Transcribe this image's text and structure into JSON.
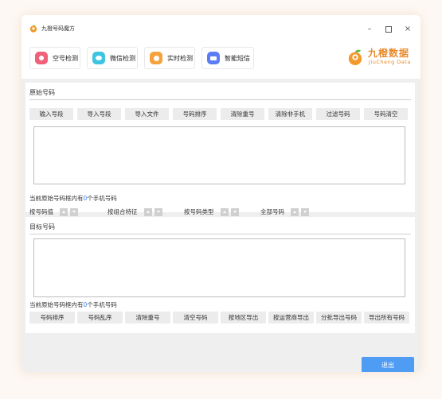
{
  "window": {
    "title": "九橙号码魔方"
  },
  "toolbar": {
    "items": [
      {
        "label": "空号检测",
        "icon": "empty-number-icon",
        "color": "#f0607a"
      },
      {
        "label": "微信检测",
        "icon": "wechat-icon",
        "color": "#3cc5e0"
      },
      {
        "label": "实时检测",
        "icon": "realtime-icon",
        "color": "#f5a23d"
      },
      {
        "label": "智能短信",
        "icon": "sms-icon",
        "color": "#5b7cf5"
      }
    ]
  },
  "logo": {
    "cn": "九橙数据",
    "en": "JiuCheng Data",
    "color": "#e88a2b"
  },
  "original": {
    "title": "原始号码",
    "buttons": [
      "输入号段",
      "导入号段",
      "导入文件",
      "号码排序",
      "清除重号",
      "清除非手机",
      "过滤号码",
      "号码清空"
    ],
    "textarea_value": "",
    "count_prefix": "当前原始号码框内有",
    "count_value": "0",
    "count_suffix": "个手机号码",
    "sort_options": [
      "按号码值",
      "按组合特征",
      "按号码类型",
      "全部号码"
    ]
  },
  "target": {
    "title": "目标号码",
    "textarea_value": "",
    "count_prefix": "当前原始号码框内有",
    "count_value": "0",
    "count_suffix": "个手机号码",
    "buttons": [
      "号码排序",
      "号码乱序",
      "清除重号",
      "清空号码",
      "按地区导出",
      "按运营商导出",
      "分批导出号码",
      "导出所有号码"
    ]
  },
  "footer": {
    "exit_label": "退出"
  },
  "colors": {
    "accent": "#4f9cf5",
    "count_highlight": "#3b82f6"
  }
}
